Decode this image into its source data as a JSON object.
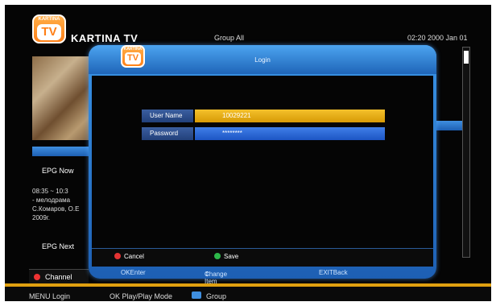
{
  "header": {
    "logo_small": "KARTINA",
    "logo_big": "TV",
    "brand": "KARTINA TV",
    "group": "Group  All",
    "clock": "02:20  2000 Jan 01"
  },
  "epg": {
    "now_label": "EPG Now",
    "desc_time": "08:35 ~ 10:3",
    "desc_line2": " - мелодрама",
    "desc_line3": "С.Комаров, О.Е",
    "desc_line4": "2009г.",
    "next_label": "EPG Next"
  },
  "dialog": {
    "logo_small": "KARTINA",
    "logo_big": "TV",
    "title": "Login",
    "username_label": "User Name",
    "username_value": "10029221",
    "password_label": "Password",
    "password_value": "********",
    "cancel_label": "Cancel",
    "save_label": "Save",
    "ok_hint": "OKEnter",
    "change_hint": "Change Item",
    "exit_hint": "EXITBack"
  },
  "bottom": {
    "channel_tab": "Channel",
    "menu_hint": "MENU Login",
    "ok_hint": "OK Play/Play Mode",
    "group_hint": "Group"
  },
  "colors": {
    "accent_blue": "#1d5fb3",
    "username_bg": "#f4c12c",
    "password_bg": "#3f7fe8",
    "cancel_btn": "#e33333",
    "save_btn": "#2db84a",
    "bottom_bar": "#e0a010"
  },
  "icons": {
    "cancel": "red-dot-icon",
    "save": "green-dot-icon",
    "change": "up-down-arrows-icon",
    "group": "folder-icon"
  }
}
